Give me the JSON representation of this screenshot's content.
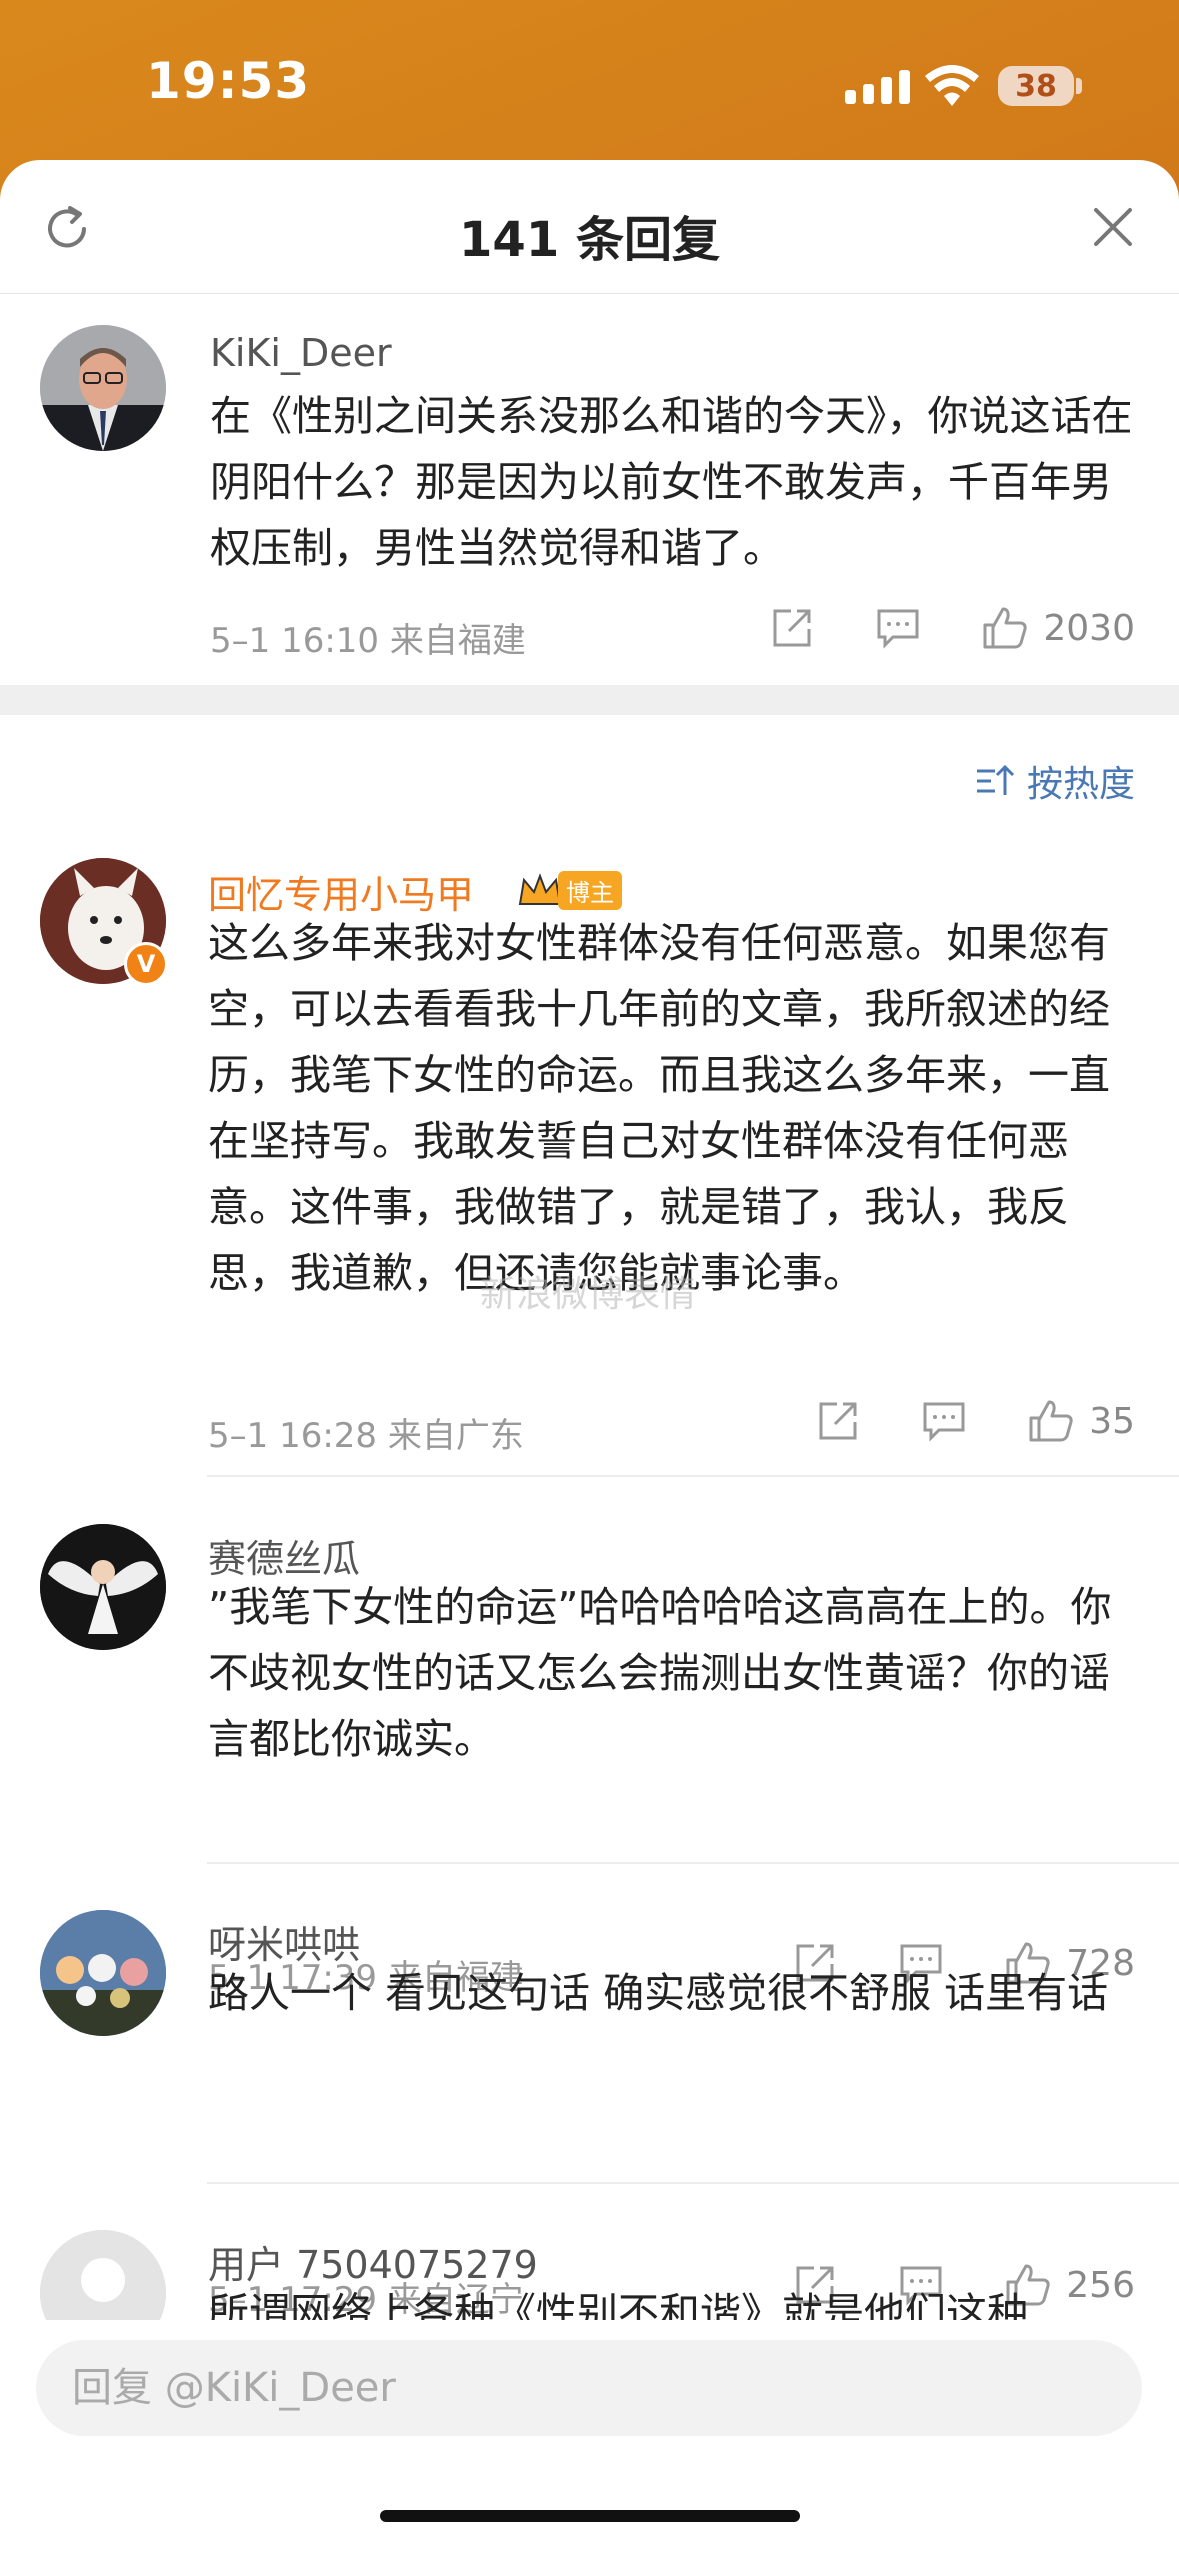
{
  "status_bar": {
    "time": "19:53",
    "battery": "38"
  },
  "header": {
    "title": "141 条回复"
  },
  "main_comment": {
    "username": "KiKi_Deer",
    "content": "在《性别之间关系没那么和谐的今天》，你说这话在阴阳什么？那是因为以前女性不敢发声，千百年男权压制，男性当然觉得和谐了。",
    "meta": "5–1 16:10  来自福建",
    "likes": "2030"
  },
  "sort": {
    "label": "按热度"
  },
  "replies": [
    {
      "username": "回忆专用小马甲",
      "badge": "博主",
      "verified_mark": "V",
      "content": "这么多年来我对女性群体没有任何恶意。如果您有空，可以去看看我十几年前的文章，我所叙述的经历，我笔下女性的命运。而且我这么多年来，一直在坚持写。我敢发誓自己对女性群体没有任何恶意。这件事，我做错了，就是错了，我认，我反思，我道歉，但还请您能就事论事。",
      "meta": "5–1 16:28  来自广东",
      "likes": "35",
      "username_color": "#f07a1f"
    },
    {
      "username": "赛德丝瓜",
      "content": "”我笔下女性的命运”哈哈哈哈哈这高高在上的。你不歧视女性的话又怎么会揣测出女性黄谣？你的谣言都比你诚实。",
      "meta": "5–1 17:39  来自福建",
      "likes": "728"
    },
    {
      "username": "呀米哄哄",
      "content": "路人一个 看见这句话 确实感觉很不舒服 话里有话",
      "meta": "5–1 17:29  来自辽宁",
      "likes": "256"
    },
    {
      "username": "用户 7504075279",
      "content": "所谓网络上各种《性别不和谐》就是他们这种"
    }
  ],
  "reply_bar": {
    "placeholder": "回复 @KiKi_Deer"
  },
  "watermark": "新浪微博表情"
}
